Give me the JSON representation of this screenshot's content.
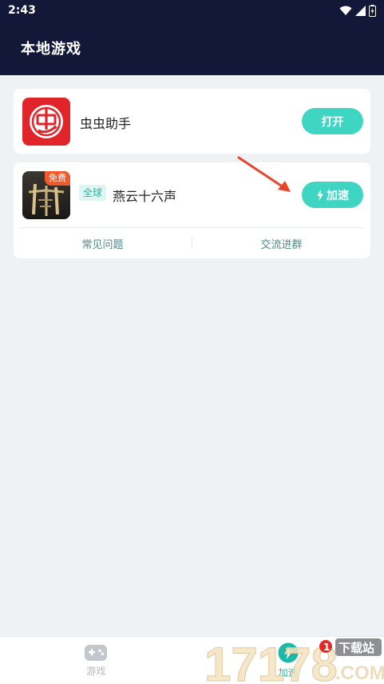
{
  "status_bar": {
    "time": "2:43"
  },
  "header": {
    "title": "本地游戏"
  },
  "apps": [
    {
      "name": "虫虫助手",
      "action": "打开",
      "icon_char": "虫"
    },
    {
      "name": "燕云十六声",
      "region": "全球",
      "free_tag": "免费",
      "action": "加速"
    }
  ],
  "card_links": [
    "常见问题",
    "交流进群"
  ],
  "tabs": [
    {
      "label": "游戏",
      "icon": "gamepad-icon"
    },
    {
      "label": "加速",
      "icon": "lightning-icon"
    }
  ],
  "watermark": {
    "text": "17178",
    "site": "下载站",
    "domain": ".COM",
    "badge": "1"
  },
  "colors": {
    "header_bg": "#141838",
    "accent": "#3ed6c2",
    "accent_text": "#1db9a6",
    "app_red": "#e1232a",
    "arrow": "#e8452c"
  }
}
